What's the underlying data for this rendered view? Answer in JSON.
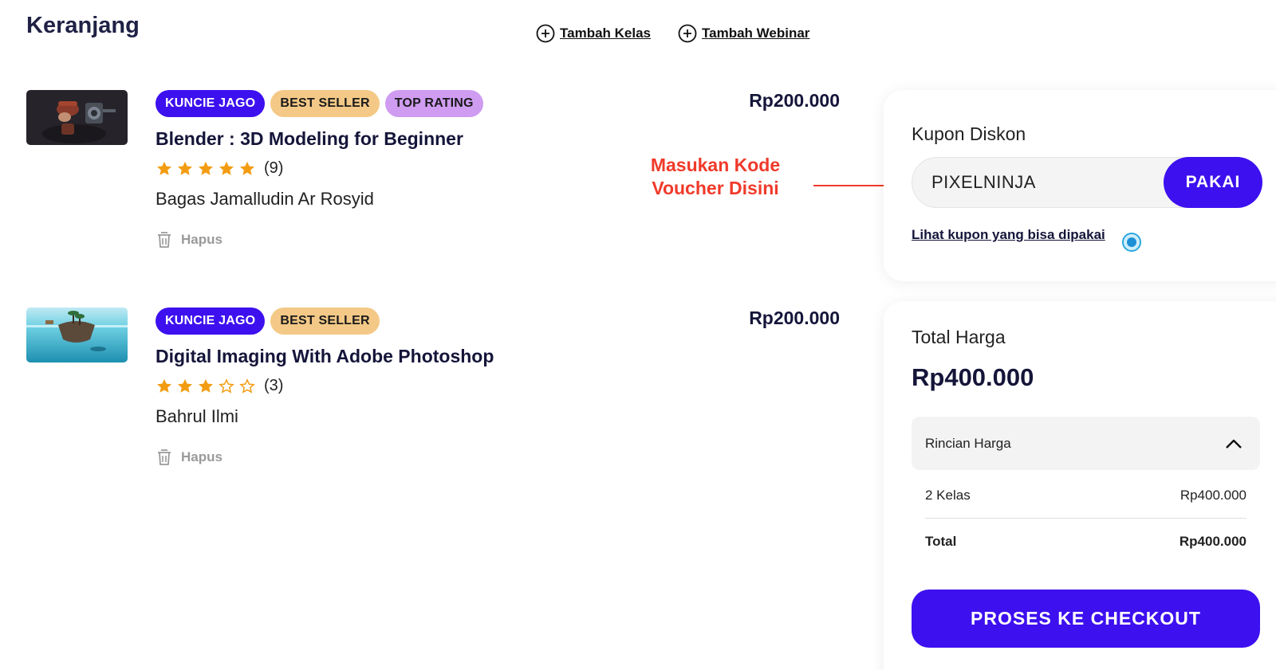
{
  "page": {
    "title": "Keranjang"
  },
  "top_links": [
    {
      "label": "Tambah Kelas",
      "icon": "plus-circle-icon"
    },
    {
      "label": "Tambah Webinar",
      "icon": "plus-circle-icon"
    }
  ],
  "courses": [
    {
      "badges": [
        "KUNCIE JAGO",
        "BEST SELLER",
        "TOP RATING"
      ],
      "title": "Blender : 3D Modeling for Beginner",
      "stars_filled": 5,
      "rating_count": "(9)",
      "instructor": "Bagas Jamalludin Ar Rosyid",
      "remove_label": "Hapus",
      "price": "Rp200.000"
    },
    {
      "badges": [
        "KUNCIE JAGO",
        "BEST SELLER"
      ],
      "title": "Digital Imaging With Adobe Photoshop",
      "stars_filled": 3,
      "rating_count": "(3)",
      "instructor": "Bahrul Ilmi",
      "remove_label": "Hapus",
      "price": "Rp200.000"
    }
  ],
  "annotation": {
    "line1": "Masukan Kode",
    "line2": "Voucher Disini"
  },
  "coupon": {
    "label": "Kupon Diskon",
    "value": "PIXELNINJA",
    "apply_label": "PAKAI",
    "link_label": "Lihat kupon yang bisa dipakai"
  },
  "summary": {
    "total_label": "Total Harga",
    "total_value": "Rp400.000",
    "details_label": "Rincian Harga",
    "rows": [
      {
        "label": "2 Kelas",
        "value": "Rp400.000"
      },
      {
        "label": "Total",
        "value": "Rp400.000"
      }
    ],
    "checkout_label": "PROSES KE CHECKOUT"
  },
  "colors": {
    "accent": "#3d10ef",
    "badge_best_seller": "#f4c987",
    "badge_top_rating": "#cf9cf1",
    "star": "#f39c12",
    "annotation": "#f03a2a"
  }
}
